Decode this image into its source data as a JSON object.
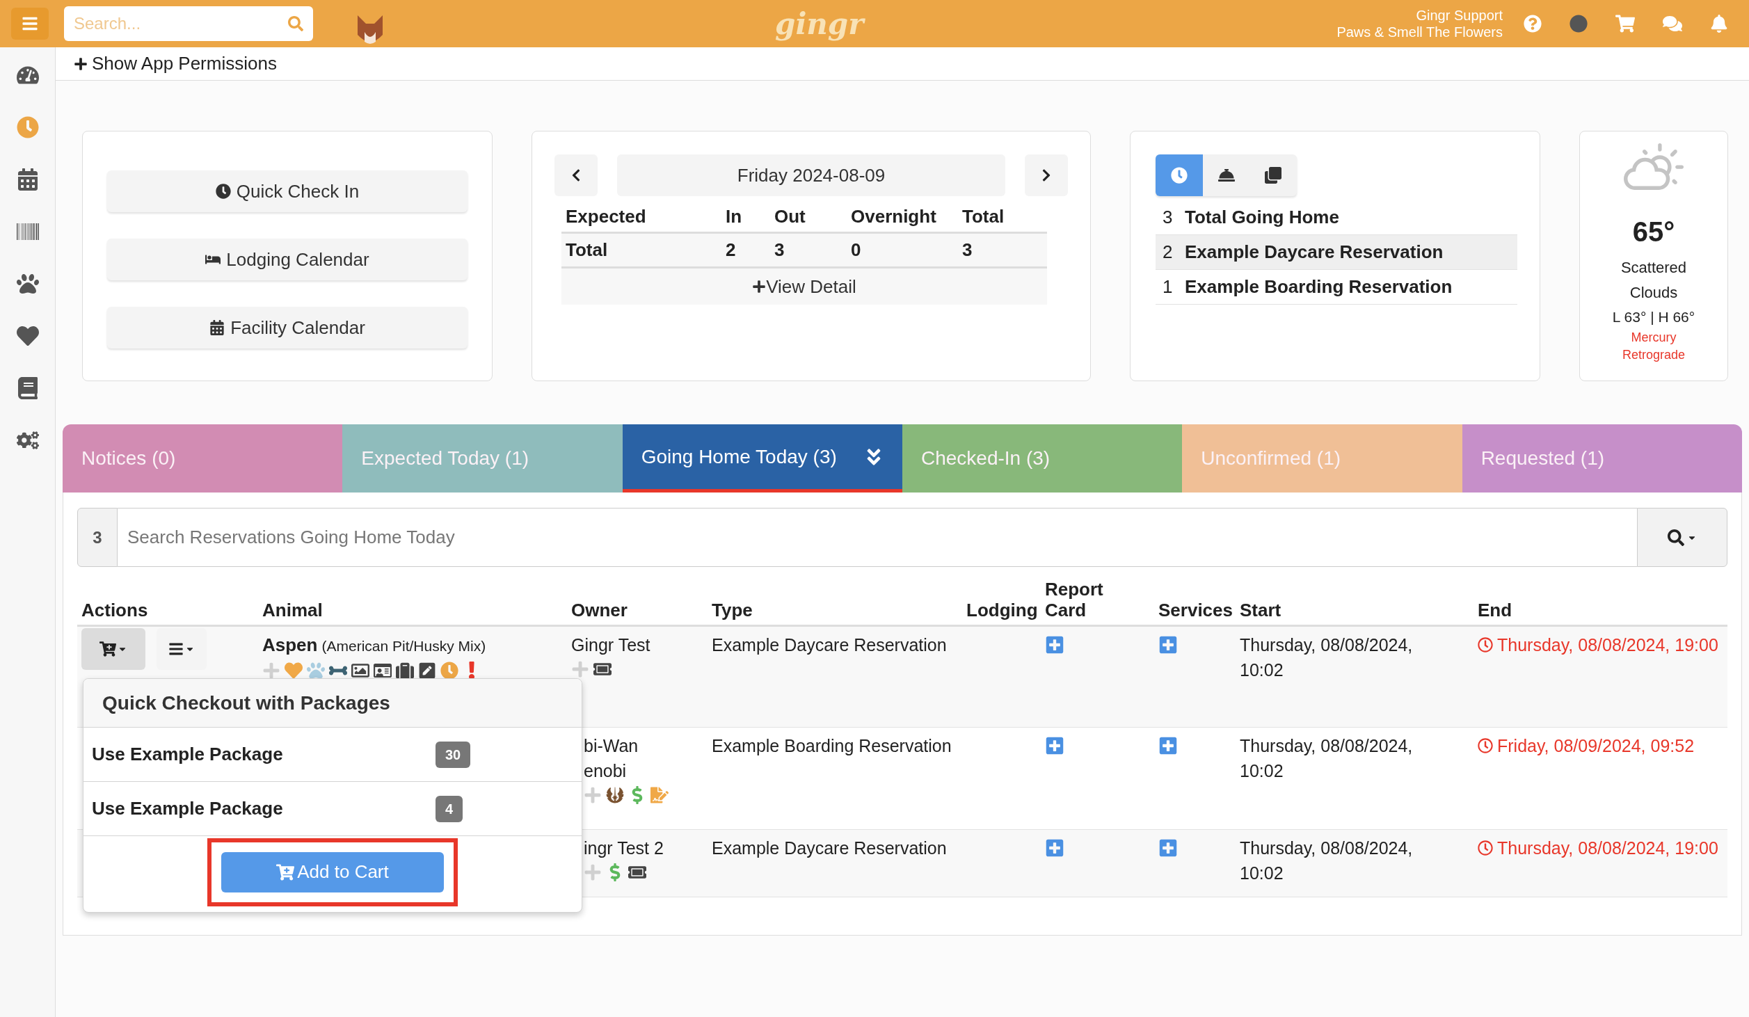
{
  "topbar": {
    "search": {
      "placeholder": "Search..."
    },
    "logo": "gingr",
    "user": {
      "name": "Gingr Support",
      "location": "Paws & Smell The Flowers"
    }
  },
  "sidebar": {
    "items": [
      {
        "selected": false
      },
      {
        "selected": true
      },
      {
        "selected": false
      },
      {
        "selected": false
      },
      {
        "selected": false
      },
      {
        "selected": false
      },
      {
        "selected": false
      },
      {
        "selected": false
      }
    ]
  },
  "permissions_link": "Show App Permissions",
  "quick_links": [
    "Quick Check In",
    "Lodging Calendar",
    "Facility Calendar"
  ],
  "expected": {
    "date": "Friday 2024-08-09",
    "columns": [
      "Expected",
      "In",
      "Out",
      "Overnight",
      "Total"
    ],
    "rows": [
      [
        "Total",
        "2",
        "3",
        "0",
        "3"
      ]
    ],
    "view_detail": "View Detail"
  },
  "going_home": {
    "views": [
      {
        "selected": true
      },
      {
        "selected": false
      },
      {
        "selected": false
      }
    ],
    "items": [
      {
        "count": "3",
        "label": "Total Going Home",
        "highlighted": false
      },
      {
        "count": "2",
        "label": "Example Daycare Reservation",
        "highlighted": true
      },
      {
        "count": "1",
        "label": "Example Boarding Reservation",
        "highlighted": false
      }
    ]
  },
  "weather": {
    "temperature": "65°",
    "condition": "Scattered Clouds",
    "range": "L 63° | H 66°",
    "note": "Mercury Retrograde"
  },
  "tabs": [
    {
      "label": "Notices (0)",
      "color": "#d28cb3",
      "selected": false
    },
    {
      "label": "Expected Today (1)",
      "color": "#8fbcbc",
      "selected": false
    },
    {
      "label": "Going Home Today (3)",
      "color": "#2a62a5",
      "selected": true
    },
    {
      "label": "Checked-In (3)",
      "color": "#88b87a",
      "selected": false
    },
    {
      "label": "Unconfirmed (1)",
      "color": "#f0bf96",
      "selected": false
    },
    {
      "label": "Requested (1)",
      "color": "#c68fc9",
      "selected": false
    }
  ],
  "search": {
    "count": "3",
    "placeholder": "Search Reservations Going Home Today"
  },
  "table": {
    "columns": [
      "Actions",
      "Animal",
      "Owner",
      "Type",
      "Lodging",
      "Report Card",
      "Services",
      "Start",
      "End"
    ],
    "rows": [
      {
        "animal": "Aspen",
        "breed": "(American Pit/Husky Mix)",
        "owner": "Gingr Test",
        "type": "Example Daycare Reservation",
        "start": "Thursday, 08/08/2024, 10:02",
        "end": "Thursday, 08/08/2024, 19:00",
        "overdue": true
      },
      {
        "owner": "bi-Wan enobi",
        "type": "Example Boarding Reservation",
        "start": "Thursday, 08/08/2024, 10:02",
        "end": "Friday, 08/09/2024, 09:52",
        "overdue": true
      },
      {
        "owner": "ingr Test 2",
        "type": "Example Daycare Reservation",
        "start": "Thursday, 08/08/2024, 10:02",
        "end": "Thursday, 08/08/2024, 19:00",
        "overdue": true
      }
    ]
  },
  "checkout_popover": {
    "title": "Quick Checkout with Packages",
    "packages": [
      {
        "label": "Use Example Package",
        "remaining": "30"
      },
      {
        "label": "Use Example Package",
        "remaining": "4"
      }
    ],
    "add_button": "Add to Cart"
  }
}
